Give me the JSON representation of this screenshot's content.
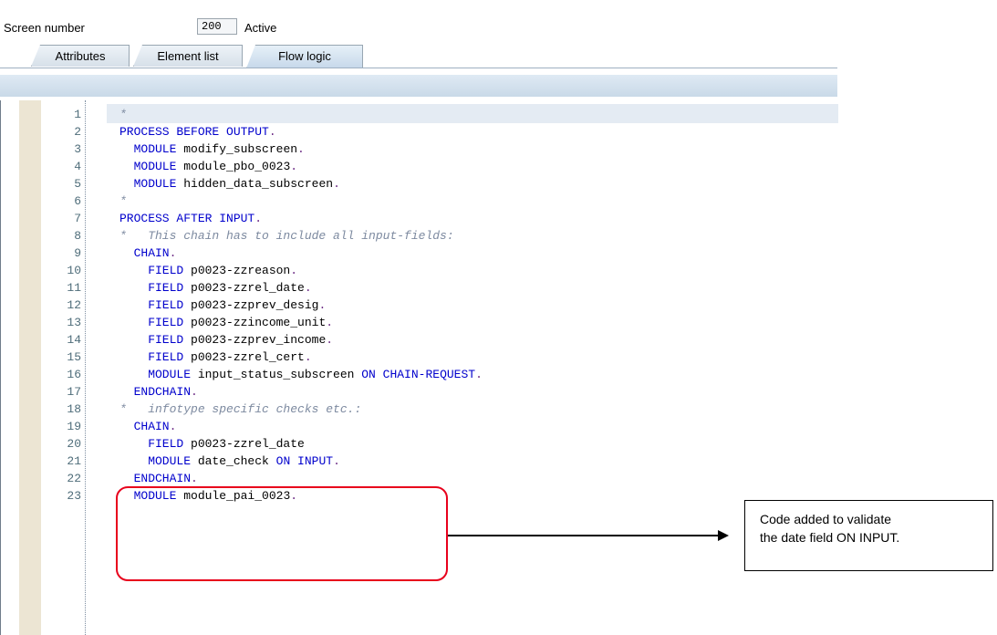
{
  "header": {
    "screen_number_label": "Screen number",
    "screen_number_value": "200",
    "status": "Active"
  },
  "tabs": [
    {
      "label": "Attributes",
      "active": false
    },
    {
      "label": "Element list",
      "active": false
    },
    {
      "label": "Flow logic",
      "active": true
    }
  ],
  "colors": {
    "keyword": "#0000cc",
    "comment": "#7d8aa0",
    "punct": "#6b2a84",
    "highlight": "#e8001c"
  },
  "code_lines": [
    {
      "n": "1",
      "tokens": [
        {
          "t": "*",
          "c": "comment"
        }
      ]
    },
    {
      "n": "2",
      "tokens": [
        {
          "t": "PROCESS BEFORE OUTPUT",
          "c": "kw"
        },
        {
          "t": ".",
          "c": "punct"
        }
      ]
    },
    {
      "n": "3",
      "tokens": [
        {
          "t": "  MODULE",
          "c": "kw"
        },
        {
          "t": " modify_subscreen",
          "c": "id"
        },
        {
          "t": ".",
          "c": "punct"
        }
      ]
    },
    {
      "n": "4",
      "tokens": [
        {
          "t": "  MODULE",
          "c": "kw"
        },
        {
          "t": " module_pbo_0023",
          "c": "id"
        },
        {
          "t": ".",
          "c": "punct"
        }
      ]
    },
    {
      "n": "5",
      "tokens": [
        {
          "t": "  MODULE",
          "c": "kw"
        },
        {
          "t": " hidden_data_subscreen",
          "c": "id"
        },
        {
          "t": ".",
          "c": "punct"
        }
      ]
    },
    {
      "n": "6",
      "tokens": [
        {
          "t": "*",
          "c": "comment"
        }
      ]
    },
    {
      "n": "7",
      "tokens": [
        {
          "t": "PROCESS AFTER INPUT",
          "c": "kw"
        },
        {
          "t": ".",
          "c": "punct"
        }
      ]
    },
    {
      "n": "8",
      "tokens": [
        {
          "t": "*   This chain has to include all input-fields:",
          "c": "comment"
        }
      ]
    },
    {
      "n": "9",
      "tokens": [
        {
          "t": "  CHAIN",
          "c": "kw"
        },
        {
          "t": ".",
          "c": "punct"
        }
      ]
    },
    {
      "n": "10",
      "tokens": [
        {
          "t": "    FIELD",
          "c": "kw"
        },
        {
          "t": " p0023-zzreason",
          "c": "id"
        },
        {
          "t": ".",
          "c": "punct"
        }
      ]
    },
    {
      "n": "11",
      "tokens": [
        {
          "t": "    FIELD",
          "c": "kw"
        },
        {
          "t": " p0023-zzrel_date",
          "c": "id"
        },
        {
          "t": ".",
          "c": "punct"
        }
      ]
    },
    {
      "n": "12",
      "tokens": [
        {
          "t": "    FIELD",
          "c": "kw"
        },
        {
          "t": " p0023-zzprev_desig",
          "c": "id"
        },
        {
          "t": ".",
          "c": "punct"
        }
      ]
    },
    {
      "n": "13",
      "tokens": [
        {
          "t": "    FIELD",
          "c": "kw"
        },
        {
          "t": " p0023-zzincome_unit",
          "c": "id"
        },
        {
          "t": ".",
          "c": "punct"
        }
      ]
    },
    {
      "n": "14",
      "tokens": [
        {
          "t": "    FIELD",
          "c": "kw"
        },
        {
          "t": " p0023-zzprev_income",
          "c": "id"
        },
        {
          "t": ".",
          "c": "punct"
        }
      ]
    },
    {
      "n": "15",
      "tokens": [
        {
          "t": "    FIELD",
          "c": "kw"
        },
        {
          "t": " p0023-zzrel_cert",
          "c": "id"
        },
        {
          "t": ".",
          "c": "punct"
        }
      ]
    },
    {
      "n": "16",
      "tokens": [
        {
          "t": "    MODULE",
          "c": "kw"
        },
        {
          "t": " input_status_subscreen ",
          "c": "id"
        },
        {
          "t": "ON CHAIN-REQUEST",
          "c": "kw"
        },
        {
          "t": ".",
          "c": "punct"
        }
      ]
    },
    {
      "n": "17",
      "tokens": [
        {
          "t": "  ENDCHAIN",
          "c": "kw"
        },
        {
          "t": ".",
          "c": "punct"
        }
      ]
    },
    {
      "n": "18",
      "tokens": [
        {
          "t": "*   infotype specific checks etc.:",
          "c": "comment"
        }
      ]
    },
    {
      "n": "19",
      "tokens": [
        {
          "t": "  CHAIN",
          "c": "kw"
        },
        {
          "t": ".",
          "c": "punct"
        }
      ]
    },
    {
      "n": "20",
      "tokens": [
        {
          "t": "    FIELD",
          "c": "kw"
        },
        {
          "t": " p0023-zzrel_date",
          "c": "id"
        }
      ]
    },
    {
      "n": "21",
      "tokens": [
        {
          "t": "    MODULE",
          "c": "kw"
        },
        {
          "t": " date_check ",
          "c": "id"
        },
        {
          "t": "ON INPUT",
          "c": "kw"
        },
        {
          "t": ".",
          "c": "punct"
        }
      ]
    },
    {
      "n": "22",
      "tokens": [
        {
          "t": "  ENDCHAIN",
          "c": "kw"
        },
        {
          "t": ".",
          "c": "punct"
        }
      ]
    },
    {
      "n": "23",
      "tokens": [
        {
          "t": "  MODULE",
          "c": "kw"
        },
        {
          "t": " module_pai_0023",
          "c": "id"
        },
        {
          "t": ".",
          "c": "punct"
        }
      ]
    }
  ],
  "annotation": {
    "text_line1": "Code added to validate",
    "text_line2": "the date field ON INPUT."
  }
}
